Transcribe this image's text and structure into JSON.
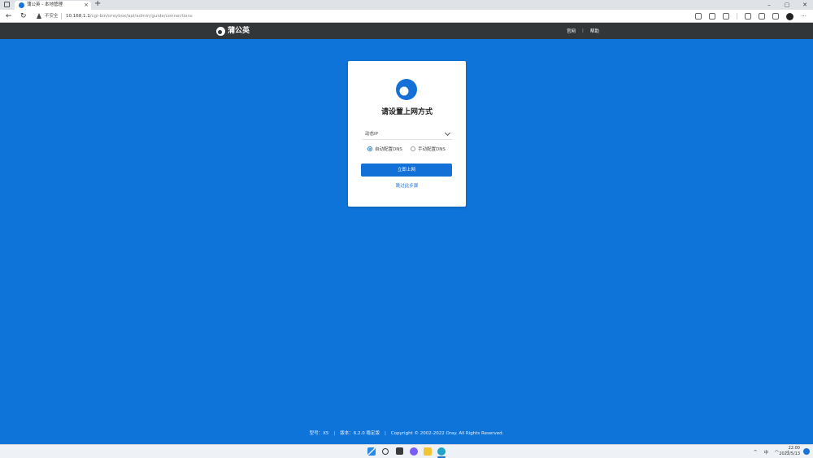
{
  "browser": {
    "tab_title": "蒲公英 - 本地管理",
    "tab_close": "×",
    "new_tab": "+",
    "security_label": "不安全",
    "url_host": "10.168.1.1",
    "url_path": "/cgi-bin/oraybox/api/admin/guide/connections",
    "back": "←",
    "refresh": "↻",
    "window_buttons": [
      "–",
      "▢",
      "✕"
    ]
  },
  "site": {
    "brand": "蒲公英",
    "nav": {
      "official": "官网",
      "separator": "|",
      "help": "帮助"
    }
  },
  "card": {
    "heading": "请设置上网方式",
    "select_value": "动态IP",
    "radio_auto": "自动配置DNS",
    "radio_manual": "手动配置DNS",
    "radio_selected": "auto",
    "submit": "立即上网",
    "skip": "跳过此步骤"
  },
  "footer": {
    "model": "型号：X5",
    "version": "版本：6.2.0 稳定版",
    "copyright": "Copyright © 2002-2022 Oray. All Rights Reserved.",
    "separator": "|"
  },
  "taskbar": {
    "tray_chevron": "^",
    "ime": "中",
    "time": "22:00",
    "date": "2022/5/13"
  },
  "colors": {
    "background": "#0f74d9",
    "header": "#333638",
    "accent": "#1270d6"
  }
}
